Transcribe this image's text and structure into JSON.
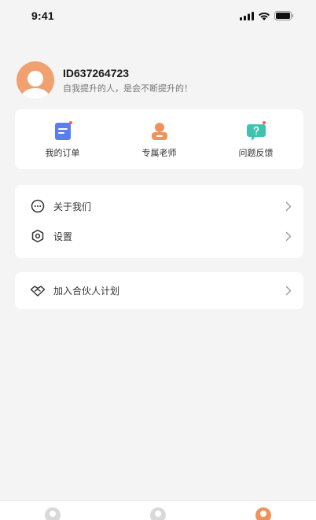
{
  "status_bar": {
    "time": "9:41"
  },
  "profile": {
    "user_id": "ID637264723",
    "motto": "自我提升的人，是会不断提升的！"
  },
  "quick_actions": [
    {
      "label": "我的订单",
      "icon": "order-document-icon",
      "color": "#5a7df0"
    },
    {
      "label": "专属老师",
      "icon": "teacher-icon",
      "color": "#f0925c"
    },
    {
      "label": "问题反馈",
      "icon": "feedback-chat-icon",
      "color": "#3fc3b0"
    }
  ],
  "menu": {
    "items": [
      {
        "label": "关于我们",
        "icon": "chat-bubble-icon"
      },
      {
        "label": "设置",
        "icon": "settings-icon"
      }
    ]
  },
  "partner": {
    "label": "加入合伙人计划",
    "icon": "handshake-icon"
  },
  "tab_bar": {
    "active_index": 2,
    "tabs": [
      {
        "icon": "home-icon"
      },
      {
        "icon": "course-icon"
      },
      {
        "icon": "profile-icon"
      }
    ]
  },
  "colors": {
    "accent": "#f0925c",
    "background": "#f4f4f5",
    "card": "#ffffff"
  }
}
